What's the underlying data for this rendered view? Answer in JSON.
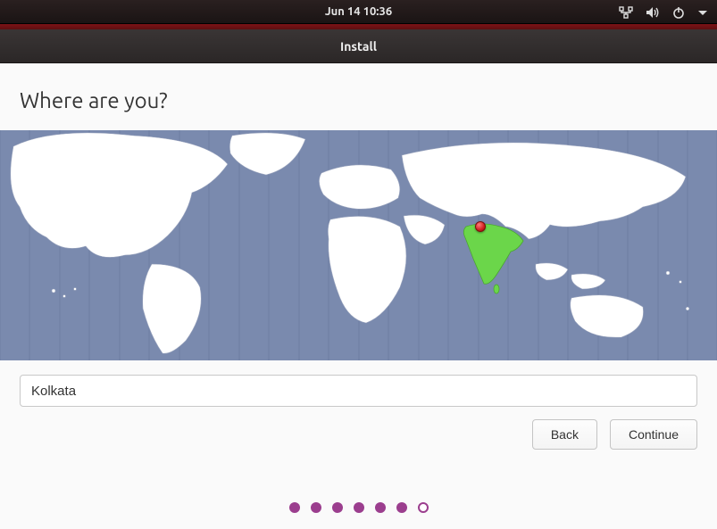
{
  "topbar": {
    "clock": "Jun 14  10:36"
  },
  "window": {
    "title": "Install"
  },
  "page": {
    "heading": "Where are you?",
    "timezone_value": "Kolkata",
    "back_label": "Back",
    "continue_label": "Continue"
  },
  "map": {
    "pin": {
      "left_pct": 67.0,
      "top_pct": 42.0
    },
    "highlight_country": "India",
    "highlight_color": "#6bd64a"
  },
  "progress": {
    "total": 7,
    "current": 6
  },
  "colors": {
    "accent_purple": "#9b3e8e",
    "accent_red": "#7b1316",
    "ocean": "#7a8aae",
    "land": "#ffffff",
    "land_stroke": "#9aa4bd"
  }
}
